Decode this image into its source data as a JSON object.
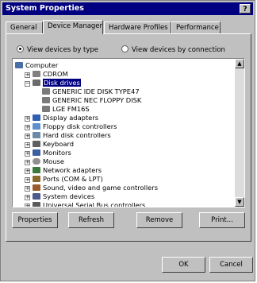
{
  "window": {
    "title": "System Properties",
    "help_label": "?"
  },
  "tabs": [
    {
      "label": "General"
    },
    {
      "label": "Device Manager"
    },
    {
      "label": "Hardware Profiles"
    },
    {
      "label": "Performance"
    }
  ],
  "view": {
    "by_type_label": "View devices by type",
    "by_connection_label": "View devices by connection",
    "selected": "by_type"
  },
  "tree": [
    {
      "label": "Computer",
      "icon": "computer-icon",
      "level": 0,
      "toggle": ""
    },
    {
      "label": "CDROM",
      "icon": "cdrom-icon",
      "level": 1,
      "toggle": "+"
    },
    {
      "label": "Disk drives",
      "icon": "disk-drives-icon",
      "level": 1,
      "toggle": "-",
      "selected": true
    },
    {
      "label": "GENERIC IDE  DISK TYPE47",
      "icon": "disk-icon",
      "level": 2,
      "toggle": ""
    },
    {
      "label": "GENERIC NEC  FLOPPY DISK",
      "icon": "disk-icon",
      "level": 2,
      "toggle": ""
    },
    {
      "label": "LGE FM16S",
      "icon": "disk-icon",
      "level": 2,
      "toggle": ""
    },
    {
      "label": "Display adapters",
      "icon": "display-adapter-icon",
      "level": 1,
      "toggle": "+"
    },
    {
      "label": "Floppy disk controllers",
      "icon": "floppy-controller-icon",
      "level": 1,
      "toggle": "+"
    },
    {
      "label": "Hard disk controllers",
      "icon": "hard-disk-controller-icon",
      "level": 1,
      "toggle": "+"
    },
    {
      "label": "Keyboard",
      "icon": "keyboard-icon",
      "level": 1,
      "toggle": "+"
    },
    {
      "label": "Monitors",
      "icon": "monitor-icon",
      "level": 1,
      "toggle": "+"
    },
    {
      "label": "Mouse",
      "icon": "mouse-icon",
      "level": 1,
      "toggle": "+"
    },
    {
      "label": "Network adapters",
      "icon": "network-adapter-icon",
      "level": 1,
      "toggle": "+"
    },
    {
      "label": "Ports (COM & LPT)",
      "icon": "ports-icon",
      "level": 1,
      "toggle": "+"
    },
    {
      "label": "Sound, video and game controllers",
      "icon": "sound-icon",
      "level": 1,
      "toggle": "+"
    },
    {
      "label": "System devices",
      "icon": "system-devices-icon",
      "level": 1,
      "toggle": "+"
    },
    {
      "label": "Universal Serial Bus controllers",
      "icon": "usb-icon",
      "level": 1,
      "toggle": "+"
    }
  ],
  "buttons": {
    "properties": "Properties",
    "refresh": "Refresh",
    "remove": "Remove",
    "print": "Print...",
    "ok": "OK",
    "cancel": "Cancel"
  },
  "colors": {
    "selection": "#000080",
    "face": "#c0c0c0"
  }
}
